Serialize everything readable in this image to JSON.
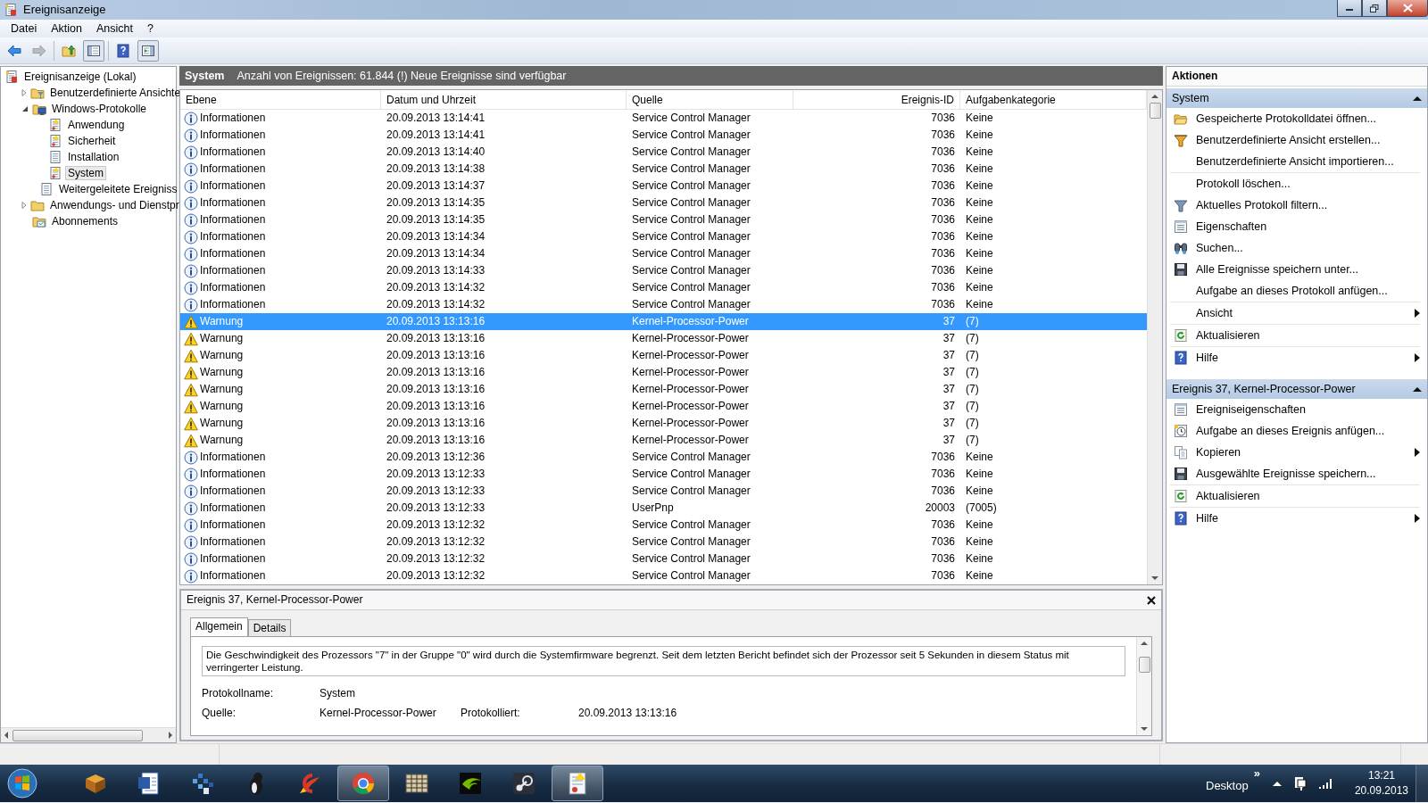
{
  "window": {
    "title": "Ereignisanzeige"
  },
  "menu": [
    "Datei",
    "Aktion",
    "Ansicht",
    "?"
  ],
  "toolbar": [
    {
      "kind": "back",
      "disabled": false,
      "pressed": false
    },
    {
      "kind": "forward",
      "disabled": true,
      "pressed": false
    },
    {
      "kind": "up",
      "disabled": false,
      "pressed": false
    },
    {
      "kind": "tree-toggle",
      "disabled": false,
      "pressed": true
    },
    {
      "kind": "help",
      "disabled": false,
      "pressed": false
    },
    {
      "kind": "pane-toggle",
      "disabled": false,
      "pressed": true
    }
  ],
  "tree": [
    {
      "label": "Ereignisanzeige (Lokal)",
      "kind": "viewer",
      "selected": false,
      "children": [
        {
          "label": "Benutzerdefinierte Ansichte",
          "kind": "folder-filter",
          "selected": false,
          "expanded": false
        },
        {
          "label": "Windows-Protokolle",
          "kind": "folder-computer",
          "selected": false,
          "expanded": true,
          "children": [
            {
              "label": "Anwendung",
              "kind": "log-warn",
              "selected": false
            },
            {
              "label": "Sicherheit",
              "kind": "log-warn",
              "selected": false
            },
            {
              "label": "Installation",
              "kind": "log",
              "selected": false
            },
            {
              "label": "System",
              "kind": "log-warn",
              "selected": true
            },
            {
              "label": "Weitergeleitete Ereigniss",
              "kind": "log",
              "selected": false
            }
          ]
        },
        {
          "label": "Anwendungs- und Dienstpr",
          "kind": "folder",
          "selected": false,
          "expanded": false
        },
        {
          "label": "Abonnements",
          "kind": "subscriptions",
          "selected": false
        }
      ]
    }
  ],
  "header": {
    "title": "System",
    "text": "Anzahl von Ereignissen: 61.844 (!) Neue Ereignisse sind verfügbar"
  },
  "table": {
    "columns": [
      "Ebene",
      "Datum und Uhrzeit",
      "Quelle",
      "Ereignis-ID",
      "Aufgabenkategorie"
    ],
    "rows": [
      {
        "kind": "info",
        "level": "Informationen",
        "date": "20.09.2013 13:14:41",
        "source": "Service Control Manager",
        "id": "7036",
        "category": "Keine",
        "selected": false
      },
      {
        "kind": "info",
        "level": "Informationen",
        "date": "20.09.2013 13:14:41",
        "source": "Service Control Manager",
        "id": "7036",
        "category": "Keine",
        "selected": false
      },
      {
        "kind": "info",
        "level": "Informationen",
        "date": "20.09.2013 13:14:40",
        "source": "Service Control Manager",
        "id": "7036",
        "category": "Keine",
        "selected": false
      },
      {
        "kind": "info",
        "level": "Informationen",
        "date": "20.09.2013 13:14:38",
        "source": "Service Control Manager",
        "id": "7036",
        "category": "Keine",
        "selected": false
      },
      {
        "kind": "info",
        "level": "Informationen",
        "date": "20.09.2013 13:14:37",
        "source": "Service Control Manager",
        "id": "7036",
        "category": "Keine",
        "selected": false
      },
      {
        "kind": "info",
        "level": "Informationen",
        "date": "20.09.2013 13:14:35",
        "source": "Service Control Manager",
        "id": "7036",
        "category": "Keine",
        "selected": false
      },
      {
        "kind": "info",
        "level": "Informationen",
        "date": "20.09.2013 13:14:35",
        "source": "Service Control Manager",
        "id": "7036",
        "category": "Keine",
        "selected": false
      },
      {
        "kind": "info",
        "level": "Informationen",
        "date": "20.09.2013 13:14:34",
        "source": "Service Control Manager",
        "id": "7036",
        "category": "Keine",
        "selected": false
      },
      {
        "kind": "info",
        "level": "Informationen",
        "date": "20.09.2013 13:14:34",
        "source": "Service Control Manager",
        "id": "7036",
        "category": "Keine",
        "selected": false
      },
      {
        "kind": "info",
        "level": "Informationen",
        "date": "20.09.2013 13:14:33",
        "source": "Service Control Manager",
        "id": "7036",
        "category": "Keine",
        "selected": false
      },
      {
        "kind": "info",
        "level": "Informationen",
        "date": "20.09.2013 13:14:32",
        "source": "Service Control Manager",
        "id": "7036",
        "category": "Keine",
        "selected": false
      },
      {
        "kind": "info",
        "level": "Informationen",
        "date": "20.09.2013 13:14:32",
        "source": "Service Control Manager",
        "id": "7036",
        "category": "Keine",
        "selected": false
      },
      {
        "kind": "warning",
        "level": "Warnung",
        "date": "20.09.2013 13:13:16",
        "source": "Kernel-Processor-Power",
        "id": "37",
        "category": "(7)",
        "selected": true
      },
      {
        "kind": "warning",
        "level": "Warnung",
        "date": "20.09.2013 13:13:16",
        "source": "Kernel-Processor-Power",
        "id": "37",
        "category": "(7)",
        "selected": false
      },
      {
        "kind": "warning",
        "level": "Warnung",
        "date": "20.09.2013 13:13:16",
        "source": "Kernel-Processor-Power",
        "id": "37",
        "category": "(7)",
        "selected": false
      },
      {
        "kind": "warning",
        "level": "Warnung",
        "date": "20.09.2013 13:13:16",
        "source": "Kernel-Processor-Power",
        "id": "37",
        "category": "(7)",
        "selected": false
      },
      {
        "kind": "warning",
        "level": "Warnung",
        "date": "20.09.2013 13:13:16",
        "source": "Kernel-Processor-Power",
        "id": "37",
        "category": "(7)",
        "selected": false
      },
      {
        "kind": "warning",
        "level": "Warnung",
        "date": "20.09.2013 13:13:16",
        "source": "Kernel-Processor-Power",
        "id": "37",
        "category": "(7)",
        "selected": false
      },
      {
        "kind": "warning",
        "level": "Warnung",
        "date": "20.09.2013 13:13:16",
        "source": "Kernel-Processor-Power",
        "id": "37",
        "category": "(7)",
        "selected": false
      },
      {
        "kind": "warning",
        "level": "Warnung",
        "date": "20.09.2013 13:13:16",
        "source": "Kernel-Processor-Power",
        "id": "37",
        "category": "(7)",
        "selected": false
      },
      {
        "kind": "info",
        "level": "Informationen",
        "date": "20.09.2013 13:12:36",
        "source": "Service Control Manager",
        "id": "7036",
        "category": "Keine",
        "selected": false
      },
      {
        "kind": "info",
        "level": "Informationen",
        "date": "20.09.2013 13:12:33",
        "source": "Service Control Manager",
        "id": "7036",
        "category": "Keine",
        "selected": false
      },
      {
        "kind": "info",
        "level": "Informationen",
        "date": "20.09.2013 13:12:33",
        "source": "Service Control Manager",
        "id": "7036",
        "category": "Keine",
        "selected": false
      },
      {
        "kind": "info",
        "level": "Informationen",
        "date": "20.09.2013 13:12:33",
        "source": "UserPnp",
        "id": "20003",
        "category": "(7005)",
        "selected": false
      },
      {
        "kind": "info",
        "level": "Informationen",
        "date": "20.09.2013 13:12:32",
        "source": "Service Control Manager",
        "id": "7036",
        "category": "Keine",
        "selected": false
      },
      {
        "kind": "info",
        "level": "Informationen",
        "date": "20.09.2013 13:12:32",
        "source": "Service Control Manager",
        "id": "7036",
        "category": "Keine",
        "selected": false
      },
      {
        "kind": "info",
        "level": "Informationen",
        "date": "20.09.2013 13:12:32",
        "source": "Service Control Manager",
        "id": "7036",
        "category": "Keine",
        "selected": false
      },
      {
        "kind": "info",
        "level": "Informationen",
        "date": "20.09.2013 13:12:32",
        "source": "Service Control Manager",
        "id": "7036",
        "category": "Keine",
        "selected": false
      }
    ]
  },
  "detail": {
    "title": "Ereignis 37, Kernel-Processor-Power",
    "tabs": [
      {
        "label": "Allgemein",
        "selected": true
      },
      {
        "label": "Details",
        "selected": false
      }
    ],
    "description": "Die Geschwindigkeit des Prozessors \"7\" in der Gruppe \"0\" wird durch die Systemfirmware begrenzt. Seit dem letzten Bericht befindet sich der Prozessor seit 5 Sekunden in diesem Status mit verringerter Leistung.",
    "rows": [
      {
        "fields": [
          {
            "label": "Protokollname:",
            "value": "System"
          }
        ]
      },
      {
        "fields": [
          {
            "label": "Quelle:",
            "value": "Kernel-Processor-Power"
          },
          {
            "label": "Protokolliert:",
            "value": "20.09.2013 13:13:16"
          }
        ]
      }
    ]
  },
  "actions": {
    "title": "Aktionen",
    "sections": [
      {
        "title": "System",
        "expanded": true,
        "groups": [
          {
            "items": [
              {
                "label": "Gespeicherte Protokolldatei öffnen...",
                "kind": "open",
                "submenu": false
              },
              {
                "label": "Benutzerdefinierte Ansicht erstellen...",
                "kind": "filter-new",
                "submenu": false
              },
              {
                "label": "Benutzerdefinierte Ansicht importieren...",
                "kind": "none",
                "submenu": false
              }
            ]
          },
          {
            "items": [
              {
                "label": "Protokoll löschen...",
                "kind": "none",
                "submenu": false
              },
              {
                "label": "Aktuelles Protokoll filtern...",
                "kind": "filter",
                "submenu": false
              },
              {
                "label": "Eigenschaften",
                "kind": "properties",
                "submenu": false
              },
              {
                "label": "Suchen...",
                "kind": "search",
                "submenu": false
              },
              {
                "label": "Alle Ereignisse speichern unter...",
                "kind": "save",
                "submenu": false
              },
              {
                "label": "Aufgabe an dieses Protokoll anfügen...",
                "kind": "none",
                "submenu": false
              }
            ]
          },
          {
            "items": [
              {
                "label": "Ansicht",
                "kind": "none",
                "submenu": true
              }
            ]
          },
          {
            "items": [
              {
                "label": "Aktualisieren",
                "kind": "refresh",
                "submenu": false
              }
            ]
          },
          {
            "items": [
              {
                "label": "Hilfe",
                "kind": "help",
                "submenu": true
              }
            ]
          }
        ]
      },
      {
        "title": "Ereignis 37, Kernel-Processor-Power",
        "expanded": true,
        "groups": [
          {
            "items": [
              {
                "label": "Ereigniseigenschaften",
                "kind": "properties",
                "submenu": false
              },
              {
                "label": "Aufgabe an dieses Ereignis anfügen...",
                "kind": "task",
                "submenu": false
              },
              {
                "label": "Kopieren",
                "kind": "copy",
                "submenu": true
              },
              {
                "label": "Ausgewählte Ereignisse speichern...",
                "kind": "save",
                "submenu": false
              }
            ]
          },
          {
            "items": [
              {
                "label": "Aktualisieren",
                "kind": "refresh",
                "submenu": false
              }
            ]
          },
          {
            "items": [
              {
                "label": "Hilfe",
                "kind": "help",
                "submenu": true
              }
            ]
          }
        ]
      }
    ]
  },
  "taskbar": {
    "apps": [
      {
        "kind": "box",
        "active": false
      },
      {
        "kind": "document",
        "active": false
      },
      {
        "kind": "grid",
        "active": false
      },
      {
        "kind": "figure",
        "active": false
      },
      {
        "kind": "brush",
        "active": false
      },
      {
        "kind": "circle",
        "active": true
      },
      {
        "kind": "cabinet",
        "active": false
      },
      {
        "kind": "eye",
        "active": false
      },
      {
        "kind": "gear",
        "active": false
      },
      {
        "kind": "log",
        "active": true
      }
    ],
    "overflow": "»",
    "desktop": "Desktop",
    "time": "13:21",
    "date": "20.09.2013"
  }
}
